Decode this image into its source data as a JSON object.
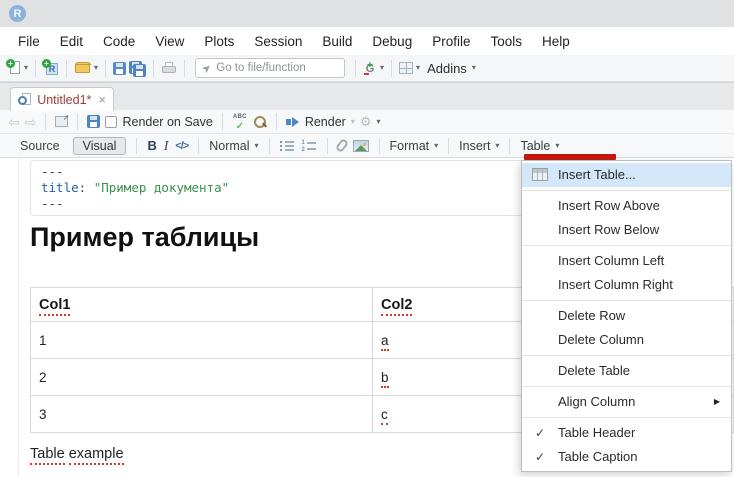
{
  "app": {
    "logo_letter": "R"
  },
  "menubar": {
    "items": [
      "File",
      "Edit",
      "Code",
      "View",
      "Plots",
      "Session",
      "Build",
      "Debug",
      "Profile",
      "Tools",
      "Help"
    ]
  },
  "toolbar": {
    "goto_placeholder": "Go to file/function",
    "addins_label": "Addins"
  },
  "tabbar": {
    "tab_label": "Untitled1*",
    "close_glyph": "×"
  },
  "doc_toolbar": {
    "render_on_save_label": "Render on Save",
    "abc_label": "ABC",
    "abc_check_glyph": "✓",
    "render_label": "Render",
    "gear_glyph": "⚙",
    "back_glyph": "⇦",
    "forward_glyph": "⇨",
    "caret_glyph": "▾"
  },
  "format_toolbar": {
    "source_label": "Source",
    "visual_label": "Visual",
    "bold_label": "B",
    "italic_label": "I",
    "code_label": "</>",
    "style_label": "Normal",
    "format_label": "Format",
    "insert_label": "Insert",
    "table_label": "Table",
    "caret_glyph": "▾"
  },
  "document": {
    "yaml_open": "---",
    "yaml_key": "title",
    "yaml_sep": ": ",
    "yaml_value": "\"Пример документа\"",
    "yaml_close": "---",
    "heading": "Пример таблицы",
    "table": {
      "col1_header": "Col1",
      "col2_header": "Col2",
      "rows": [
        [
          "1",
          "a"
        ],
        [
          "2",
          "b"
        ],
        [
          "3",
          "c"
        ]
      ]
    },
    "caption_word1": "Table",
    "caption_word2": "example"
  },
  "context_menu": {
    "check_glyph": "✓",
    "submenu_glyph": "▶",
    "items": [
      {
        "label": "Insert Table..."
      },
      {
        "label": "Insert Row Above"
      },
      {
        "label": "Insert Row Below"
      },
      {
        "label": "Insert Column Left"
      },
      {
        "label": "Insert Column Right"
      },
      {
        "label": "Delete Row"
      },
      {
        "label": "Delete Column"
      },
      {
        "label": "Delete Table"
      },
      {
        "label": "Align Column"
      },
      {
        "label": "Table Header",
        "checked": true
      },
      {
        "label": "Table Caption",
        "checked": true
      }
    ]
  },
  "colors": {
    "menu_highlight": "#d3e7f8",
    "annotation_red": "#c1170f",
    "modified_tab_text": "#9b3c38",
    "yaml_key_blue": "#2262a8",
    "yaml_string_green": "#3a9150",
    "spellcheck_red": "#cf3a2c"
  }
}
